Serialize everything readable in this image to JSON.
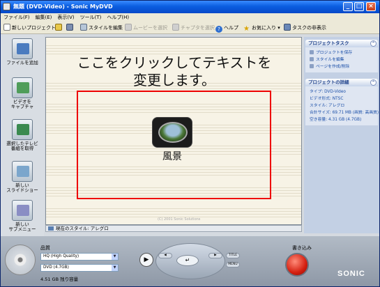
{
  "window": {
    "title": "無題 (DVD-Video) - Sonic MyDVD"
  },
  "menu": [
    "ファイル(F)",
    "編集(E)",
    "表示(V)",
    "ツール(T)",
    "ヘルプ(H)"
  ],
  "toolbar": {
    "new_project": "新しいプロジェクト",
    "edit_style": "スタイルを編集",
    "menu_select": "ムービーを選択",
    "chapter_select": "チャプタを選択",
    "help": "ヘルプ",
    "favorites": "お気に入り",
    "task_view": "タスクの非表示"
  },
  "sidebar": {
    "items": [
      {
        "label": "ファイルを追加"
      },
      {
        "label": "ビデオを\nキャプチャ"
      },
      {
        "label": "選択したテレビ\n番組を取得"
      },
      {
        "label": "新しい\nスライドショー"
      },
      {
        "label": "新しい\nサブメニュー"
      }
    ]
  },
  "canvas": {
    "headline_line1": "ここをクリックしてテキストを",
    "headline_line2": "変更します。",
    "thumbnail_label": "風景",
    "copyright": "(C) 2001 Sonic Solutions"
  },
  "stylebar": {
    "label": "現在のスタイル: アレグロ"
  },
  "rightpanel": {
    "tasks_header": "プロジェクトタスク",
    "tasks": [
      "プロジェクトを保存",
      "スタイルを編集",
      "ページを作成/削除"
    ],
    "details_header": "プロジェクトの詳細",
    "details": [
      "タイプ: DVD-Video",
      "ビデオ形式: NTSC",
      "スタイル: アレグロ",
      "合計サイズ: 69.71 MB (画質: 高画質)",
      "空き容量: 4.31 GB (4.7GB)"
    ]
  },
  "bottom": {
    "quality_label": "品質",
    "quality_value": "HQ (High Quality)",
    "media_value": "DVD (4.7GB)",
    "capacity": "4.51 GB 残り容量",
    "title_btn": "TITLE",
    "menu_btn": "MENU",
    "burn_label": "書き込み",
    "brand": "SONIC"
  },
  "colors": {
    "accent_red": "#e00000",
    "titlebar_blue": "#0a5ee0",
    "canvas_bg": "#f7f3e6"
  }
}
